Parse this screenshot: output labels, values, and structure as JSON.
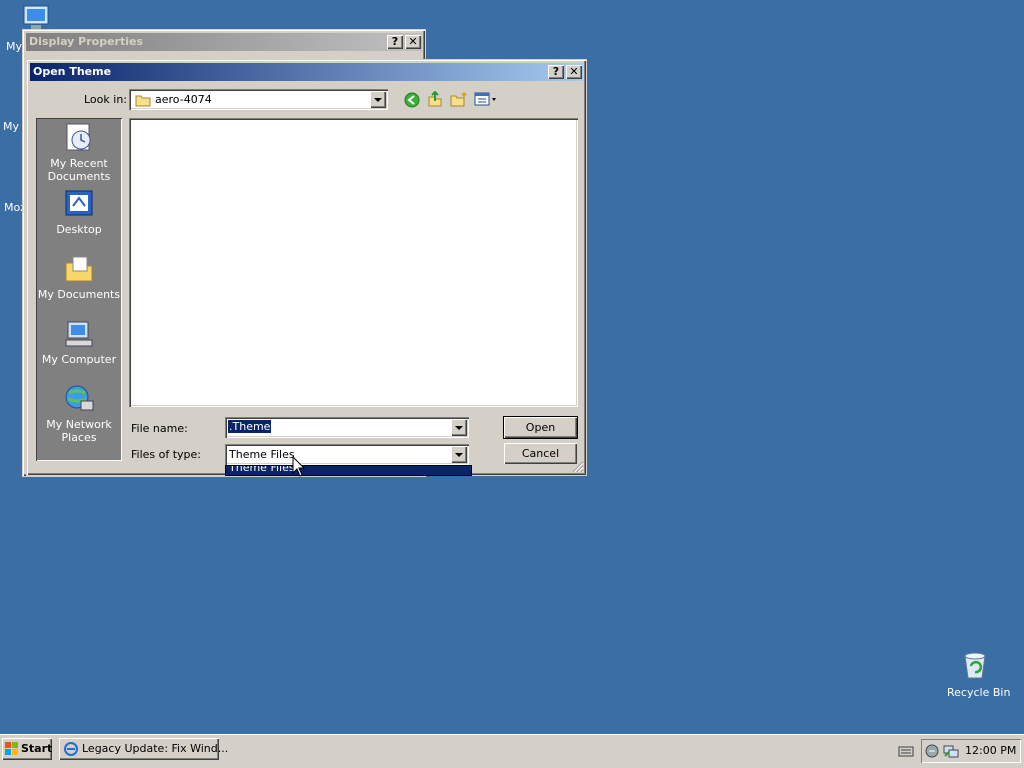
{
  "desktop": {
    "icons": [
      {
        "label": "My",
        "icon": "my-documents-icon"
      },
      {
        "label": "My I",
        "icon": "computer-icon"
      },
      {
        "label": "Moz",
        "icon": "browser-icon"
      }
    ],
    "recycle_bin": {
      "label": "Recycle Bin",
      "icon": "recycle-bin-icon"
    }
  },
  "display_properties": {
    "title": "Display Properties",
    "help": "?",
    "close": "✕"
  },
  "open_dialog": {
    "title": "Open Theme",
    "help": "?",
    "close": "✕",
    "look_in_label": "Look in:",
    "look_in_value": "aero-4074",
    "places": [
      {
        "label": "My Recent Documents",
        "icon": "recent-documents-icon"
      },
      {
        "label": "Desktop",
        "icon": "desktop-icon"
      },
      {
        "label": "My Documents",
        "icon": "my-documents-icon"
      },
      {
        "label": "My Computer",
        "icon": "my-computer-icon"
      },
      {
        "label": "My Network Places",
        "icon": "network-places-icon"
      }
    ],
    "file_name_label": "File name:",
    "file_name_value": ".Theme",
    "file_type_label": "Files of type:",
    "file_type_value": "Theme Files",
    "dropdown_option": "Theme Files",
    "open_button": "Open",
    "cancel_button": "Cancel"
  },
  "taskbar": {
    "start": "Start",
    "task": "Legacy Update: Fix Wind...",
    "clock": "12:00 PM"
  },
  "colors": {
    "desktop": "#3a6ea5",
    "titlebar_active": "#0a246a",
    "face": "#d4d0c8",
    "selection": "#0a246a"
  }
}
